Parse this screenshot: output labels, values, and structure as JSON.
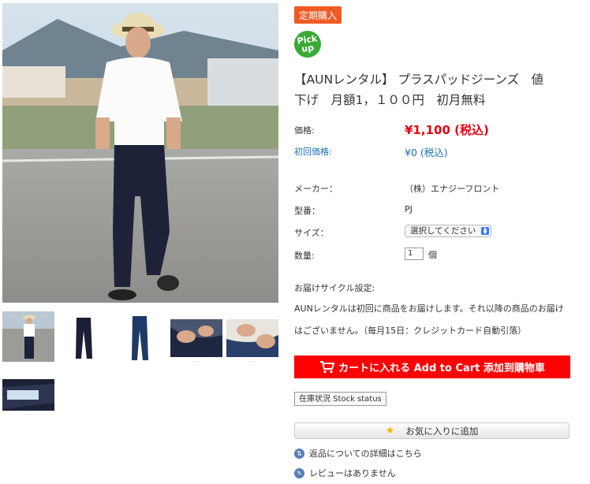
{
  "badges": {
    "subscription": "定期購入",
    "pickup_line1": "Pick",
    "pickup_line2": "up"
  },
  "product": {
    "title": "【AUNレンタル】 プラスパッドジーンズ　値下げ　月額1，１００円　初月無料",
    "price_label": "価格:",
    "price_value": "¥1,100 (税込)",
    "first_price_label": "初回価格:",
    "first_price_value": "¥0 (税込)",
    "maker_label": "メーカー：",
    "maker_value": "（株）エナジーフロント",
    "model_label": "型番：",
    "model_value": "PJ",
    "size_label": "サイズ：",
    "size_selected": "選択してください",
    "quantity_label": "数量:",
    "quantity_value": "1",
    "quantity_unit": "個"
  },
  "delivery": {
    "heading": "お届けサイクル設定:",
    "text": "AUNレンタルは初回に商品をお届けします。それ以降の商品のお届けはございません。（毎月15日：クレジットカード自動引落）"
  },
  "actions": {
    "cart_label": "カートに入れる Add to Cart 添加到購物車",
    "stock_label": "在庫状況 Stock status",
    "favorite_label": "お気に入りに追加",
    "return_link": "返品についての詳細はこちら",
    "review_link": "レビューはありません"
  },
  "colors": {
    "price": "#e60012",
    "first_price": "#1a6fc2",
    "cart": "#ff0000",
    "subscription_badge": "#f15a22",
    "pickup_badge": "#3aaa35"
  },
  "icons": {
    "cart": "cart-icon",
    "star": "star-icon",
    "return": "return-icon",
    "review": "review-icon"
  }
}
